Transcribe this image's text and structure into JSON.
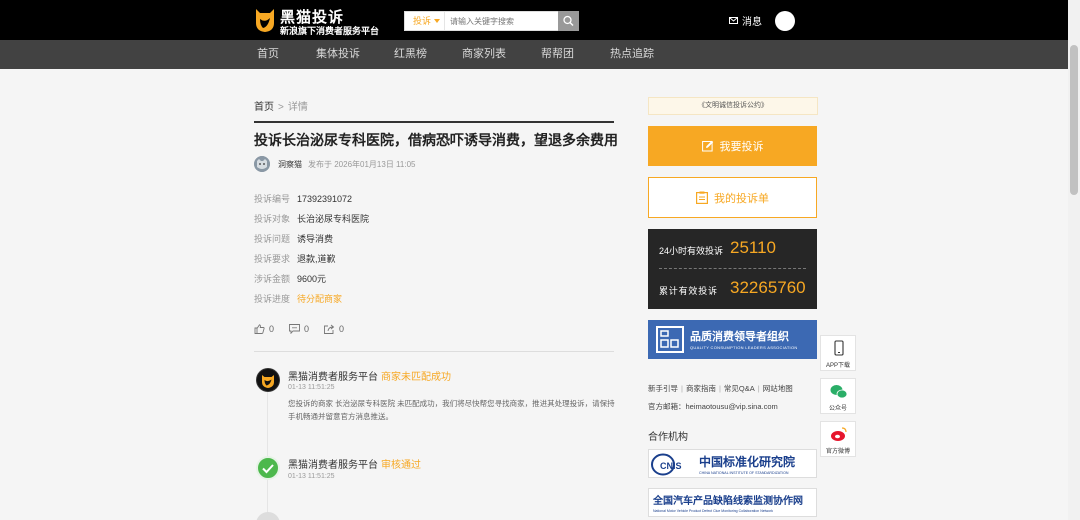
{
  "header": {
    "logo_title": "黑猫投诉",
    "logo_sub": "新浪旗下消费者服务平台",
    "search_category": "投诉",
    "search_placeholder": "请输入关键字搜索",
    "messages_label": "消息"
  },
  "nav": {
    "items": [
      {
        "label": "首页"
      },
      {
        "label": "集体投诉"
      },
      {
        "label": "红黑榜"
      },
      {
        "label": "商家列表"
      },
      {
        "label": "帮帮团"
      },
      {
        "label": "热点追踪"
      }
    ]
  },
  "breadcrumb": {
    "home": "首页",
    "separator": ">",
    "current": "详情"
  },
  "complaint": {
    "title": "投诉长治泌尿专科医院，借病恐吓诱导消费，望退多余费用",
    "author": "洞察猫",
    "published": "发布于 2026年01月13日 11:05",
    "fields": [
      {
        "key": "投诉编号",
        "value": "17392391072"
      },
      {
        "key": "投诉对象",
        "value": "长治泌尿专科医院"
      },
      {
        "key": "投诉问题",
        "value": "诱导消费"
      },
      {
        "key": "投诉要求",
        "value": "退款,道歉"
      },
      {
        "key": "涉诉金额",
        "value": "9600元"
      },
      {
        "key": "投诉进度",
        "value": "待分配商家"
      }
    ],
    "likes": "0",
    "comments": "0",
    "shares": "0"
  },
  "timeline": [
    {
      "actor": "黑猫消费者服务平台",
      "status": "商家未匹配成功",
      "time": "01-13 11:51:25",
      "text": "您投诉的商家 长治泌尿专科医院 未匹配成功，我们将尽快帮您寻找商家，推进其处理投诉，请保持手机畅通并留意官方消息推送。"
    },
    {
      "actor": "黑猫消费者服务平台",
      "status": "审核通过",
      "time": "01-13 11:51:25",
      "text": ""
    }
  ],
  "sidebar": {
    "convention": "《文明诚信投诉公约》",
    "complain_button": "我要投诉",
    "my_list_button": "我的投诉单",
    "stat_24h_label": "24小时有效投诉",
    "stat_24h_value": "25110",
    "stat_total_label": "累计有效投诉",
    "stat_total_value": "32265760",
    "banner_title": "品质消费领导者组织",
    "banner_sub": "QUALITY CONSUMPTION LEADERS ASSOCIATION",
    "links": [
      "新手引导",
      "商家指南",
      "常见Q&A",
      "网站地图"
    ],
    "email": "官方邮箱：heimaotousu@vip.sina.com",
    "partners_heading": "合作机构",
    "partner1_cn": "中国标准化研究院",
    "partner1_en": "CHINA NATIONAL INSTITUTE OF STANDARDIZATION",
    "partner1_abbr": "CNIS",
    "partner2_cn": "全国汽车产品缺陷线索监测协作网",
    "partner2_en": "National Motor Vehicle Product Defect Clue Monitoring Collaboration Network"
  },
  "floating": {
    "app": "APP下载",
    "wechat": "公众号",
    "weibo": "官方微博"
  },
  "colors": {
    "accent": "#f7a823",
    "topbar": "#000000",
    "navbar": "#424242",
    "stats_bg": "#262626",
    "banner": "#3c69b3"
  }
}
